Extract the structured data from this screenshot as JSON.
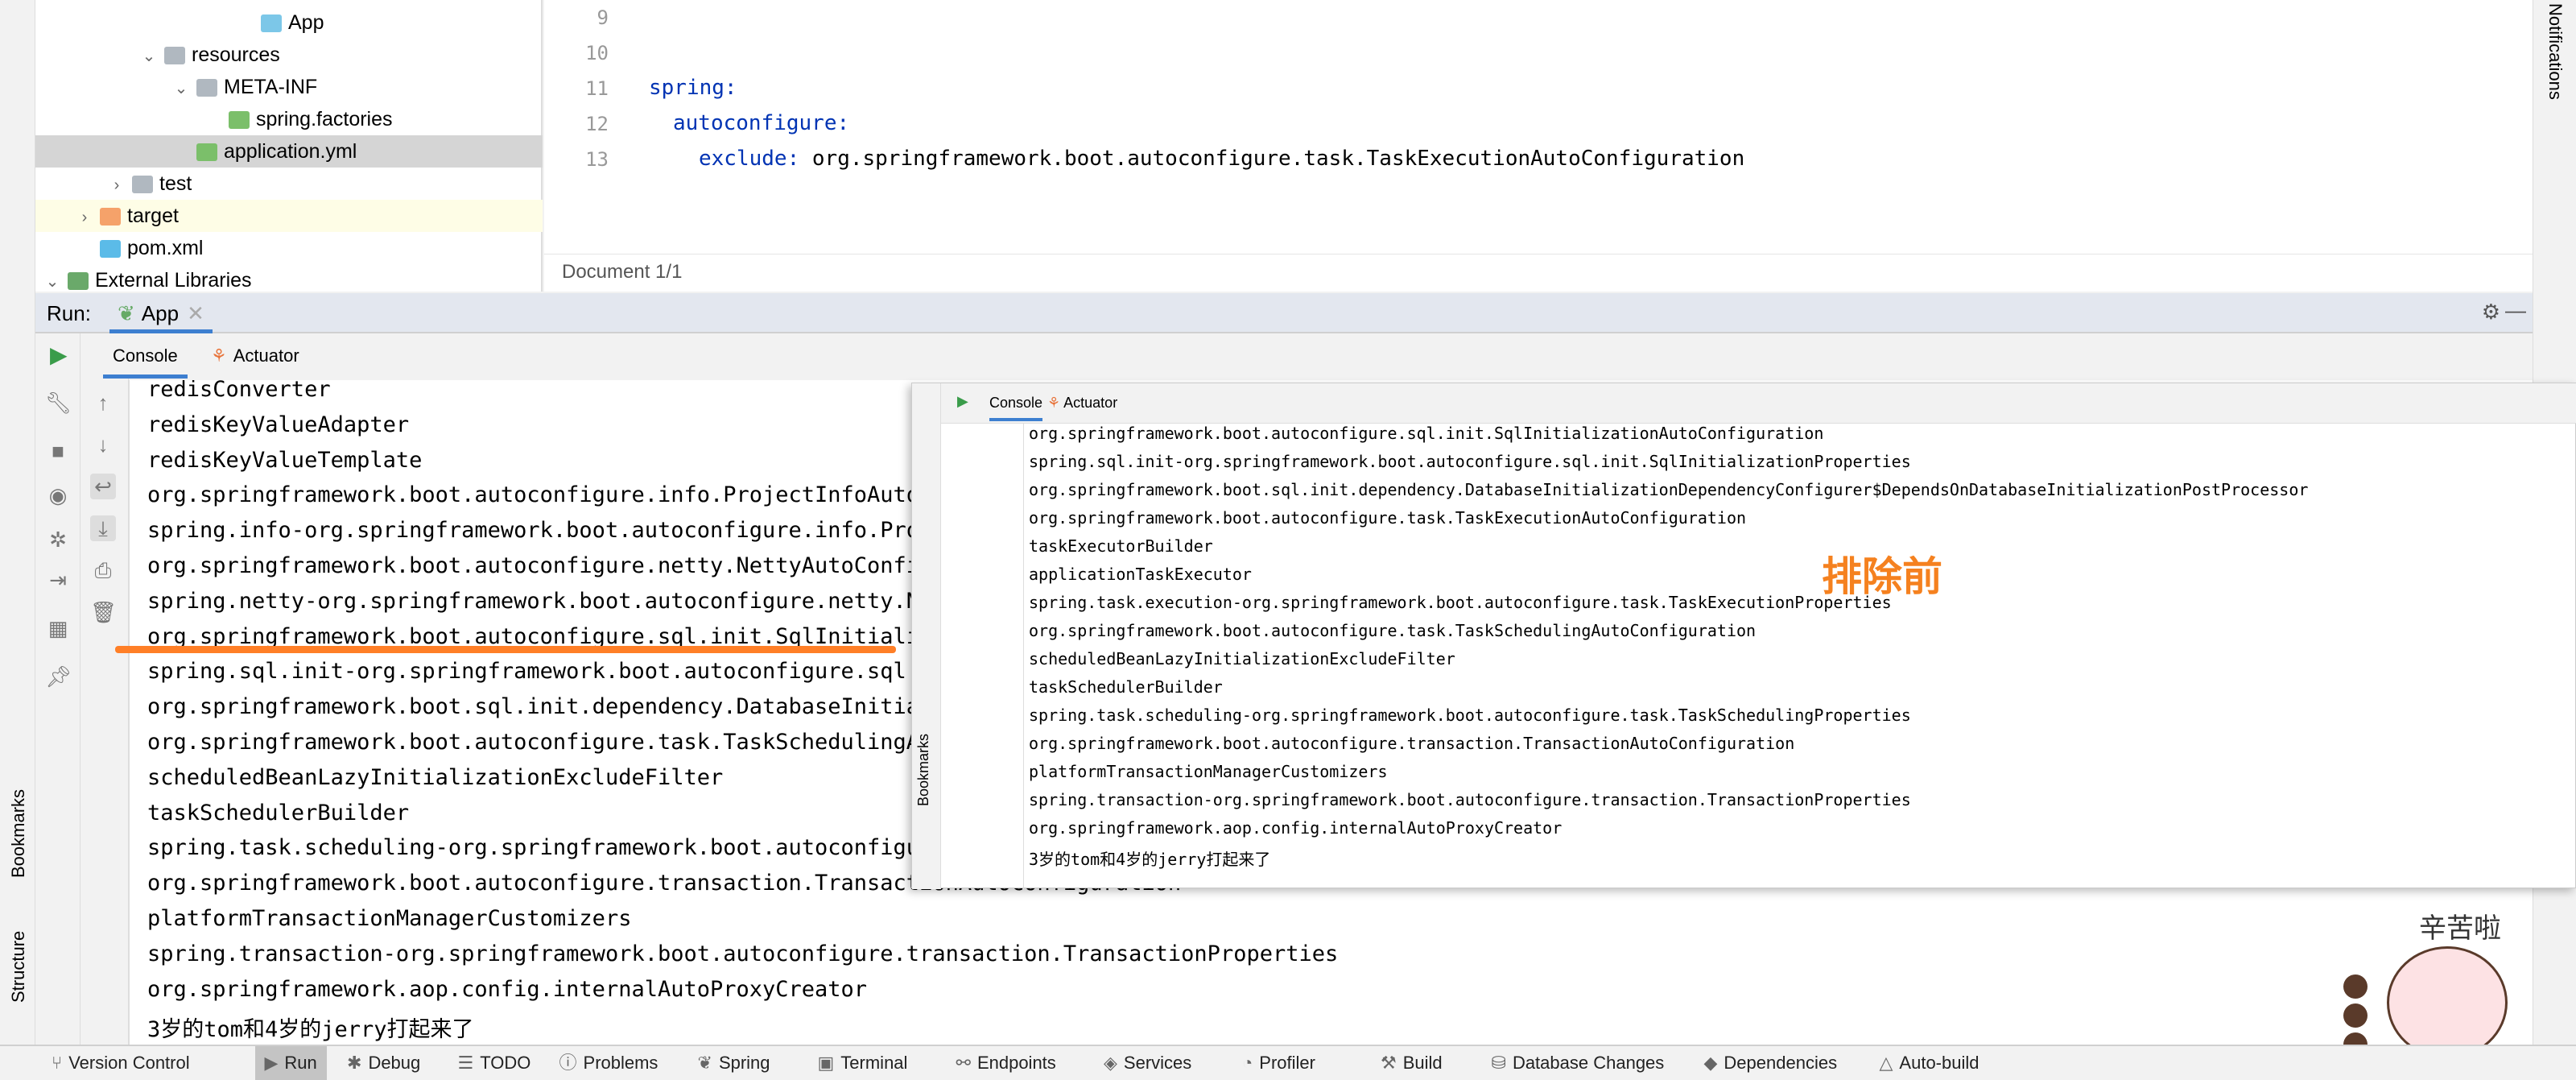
{
  "tree": [
    {
      "label": "App",
      "icon": "spring-boot-app-icon",
      "indent": 6
    },
    {
      "label": "resources",
      "icon": "resources-folder-icon",
      "indent": 3,
      "expanded": true
    },
    {
      "label": "META-INF",
      "icon": "folder-icon",
      "indent": 4,
      "expanded": true
    },
    {
      "label": "spring.factories",
      "icon": "spring-factories-icon",
      "indent": 5
    },
    {
      "label": "application.yml",
      "icon": "spring-yml-icon",
      "indent": 4,
      "selected": true
    },
    {
      "label": "test",
      "icon": "folder-icon",
      "indent": 2,
      "expanded": false
    },
    {
      "label": "target",
      "icon": "excluded-folder-icon",
      "indent": 1,
      "expanded": false
    },
    {
      "label": "pom.xml",
      "icon": "maven-icon",
      "indent": 1
    },
    {
      "label": "External Libraries",
      "icon": "libraries-icon",
      "indent": 0,
      "expanded": true
    }
  ],
  "editor": {
    "line_numbers": [
      "9",
      "10",
      "11",
      "12",
      "13"
    ],
    "lines": [
      {
        "key": "spring:",
        "value": ""
      },
      {
        "key": "autoconfigure:",
        "value": ""
      },
      {
        "key": "exclude:",
        "value": " org.springframework.boot.autoconfigure.task.TaskExecutionAutoConfiguration"
      }
    ],
    "status": "Document 1/1"
  },
  "right_strip": "Notifications",
  "left_strip": {
    "bookmarks": "Bookmarks",
    "structure": "Structure"
  },
  "run": {
    "label": "Run:",
    "tab": "App",
    "tabs": [
      "Console",
      "Actuator"
    ]
  },
  "console_lines": [
    "redisConverter",
    "redisKeyValueAdapter",
    "redisKeyValueTemplate",
    "org.springframework.boot.autoconfigure.info.ProjectInfoAutoConfiguration",
    "spring.info-org.springframework.boot.autoconfigure.info.ProjectInfoProperties",
    "org.springframework.boot.autoconfigure.netty.NettyAutoConfiguration",
    "spring.netty-org.springframework.boot.autoconfigure.netty.NettyProperties",
    "org.springframework.boot.autoconfigure.sql.init.SqlInitializationAutoConfiguration",
    "spring.sql.init-org.springframework.boot.autoconfigure.sql.init.SqlInitializationProperties",
    "org.springframework.boot.sql.init.dependency.DatabaseInitializationDependencyConfigurer",
    "org.springframework.boot.autoconfigure.task.TaskSchedulingAutoConfiguration",
    "scheduledBeanLazyInitializationExcludeFilter",
    "taskSchedulerBuilder",
    "spring.task.scheduling-org.springframework.boot.autoconfigure.task.TaskSchedulingProperties",
    "org.springframework.boot.autoconfigure.transaction.TransactionAutoConfiguration",
    "platformTransactionManagerCustomizers",
    "spring.transaction-org.springframework.boot.autoconfigure.transaction.TransactionProperties",
    "org.springframework.aop.config.internalAutoProxyCreator",
    "3岁的tom和4岁的jerry打起来了"
  ],
  "overlay": {
    "tabs": [
      "Console",
      "Actuator"
    ],
    "annotation": "排除前",
    "annotation_color": "#f5811f",
    "lines": [
      "org.springframework.boot.autoconfigure.sql.init.SqlInitializationAutoConfiguration",
      "spring.sql.init-org.springframework.boot.autoconfigure.sql.init.SqlInitializationProperties",
      "org.springframework.boot.sql.init.dependency.DatabaseInitializationDependencyConfigurer$DependsOnDatabaseInitializationPostProcessor",
      "org.springframework.boot.autoconfigure.task.TaskExecutionAutoConfiguration",
      "taskExecutorBuilder",
      "applicationTaskExecutor",
      "spring.task.execution-org.springframework.boot.autoconfigure.task.TaskExecutionProperties",
      "org.springframework.boot.autoconfigure.task.TaskSchedulingAutoConfiguration",
      "scheduledBeanLazyInitializationExcludeFilter",
      "taskSchedulerBuilder",
      "spring.task.scheduling-org.springframework.boot.autoconfigure.task.TaskSchedulingProperties",
      "org.springframework.boot.autoconfigure.transaction.TransactionAutoConfiguration",
      "platformTransactionManagerCustomizers",
      "spring.transaction-org.springframework.boot.autoconfigure.transaction.TransactionProperties",
      "org.springframework.aop.config.internalAutoProxyCreator",
      "3岁的tom和4岁的jerry打起来了"
    ]
  },
  "highlight_color": "#ff7f27",
  "status_bar": [
    {
      "label": "Version Control",
      "icon": "⑂"
    },
    {
      "label": "Run",
      "icon": "▶",
      "active": true
    },
    {
      "label": "Debug",
      "icon": "✱"
    },
    {
      "label": "TODO",
      "icon": "☰"
    },
    {
      "label": "Problems",
      "icon": "ⓘ"
    },
    {
      "label": "Spring",
      "icon": "❦"
    },
    {
      "label": "Terminal",
      "icon": "▣"
    },
    {
      "label": "Endpoints",
      "icon": "⚯"
    },
    {
      "label": "Services",
      "icon": "◈"
    },
    {
      "label": "Profiler",
      "icon": "◔"
    },
    {
      "label": "Build",
      "icon": "⚒"
    },
    {
      "label": "Database Changes",
      "icon": "⛁"
    },
    {
      "label": "Dependencies",
      "icon": "◆"
    },
    {
      "label": "Auto-build",
      "icon": "△"
    }
  ],
  "sticker": {
    "text": "辛苦啦"
  }
}
